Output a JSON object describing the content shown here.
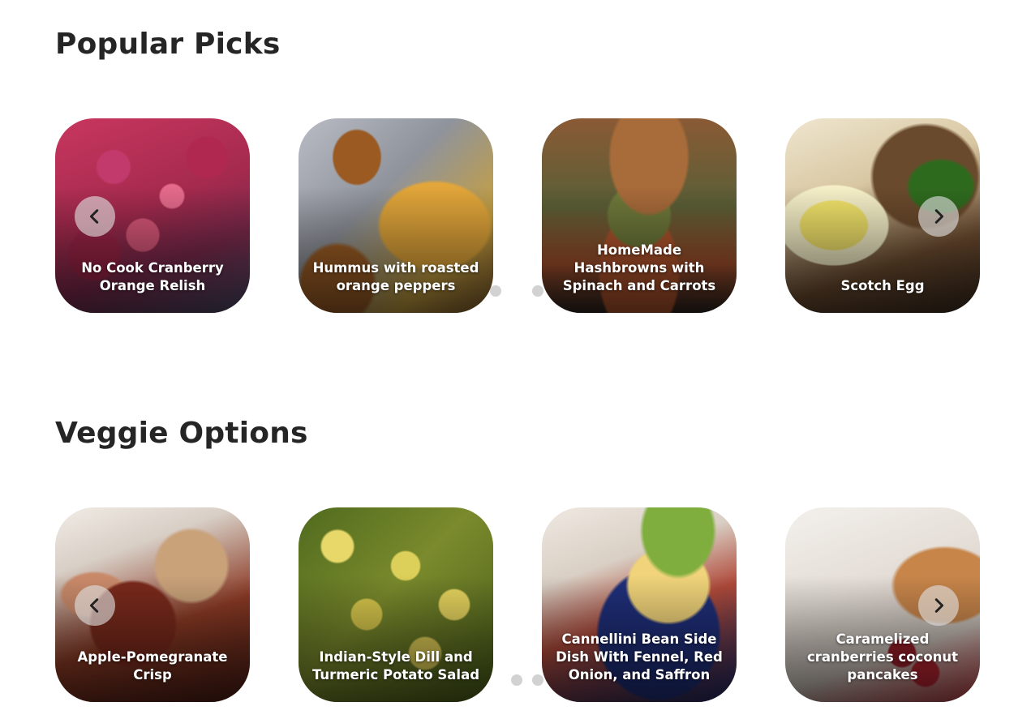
{
  "sections": [
    {
      "title": "Popular Picks",
      "cards": [
        {
          "title": "No Cook Cranberry Orange Relish"
        },
        {
          "title": "Hummus with roasted orange peppers"
        },
        {
          "title": "HomeMade Hashbrowns with Spinach and Carrots"
        },
        {
          "title": "Scotch Egg"
        }
      ]
    },
    {
      "title": "Veggie Options",
      "cards": [
        {
          "title": "Apple-Pomegranate Crisp"
        },
        {
          "title": "Indian-Style Dill and Turmeric Potato Salad"
        },
        {
          "title": "Cannellini Bean Side Dish With Fennel, Red Onion, and Saffron"
        },
        {
          "title": "Caramelized cranberries coconut pancakes"
        }
      ]
    }
  ],
  "icons": {
    "prev": "chevron-left-icon",
    "next": "chevron-right-icon"
  },
  "colors": {
    "heading": "#252525",
    "caption": "#ffffff",
    "nav_button": "#e1e1e1",
    "dot": "#d2d2d2"
  }
}
